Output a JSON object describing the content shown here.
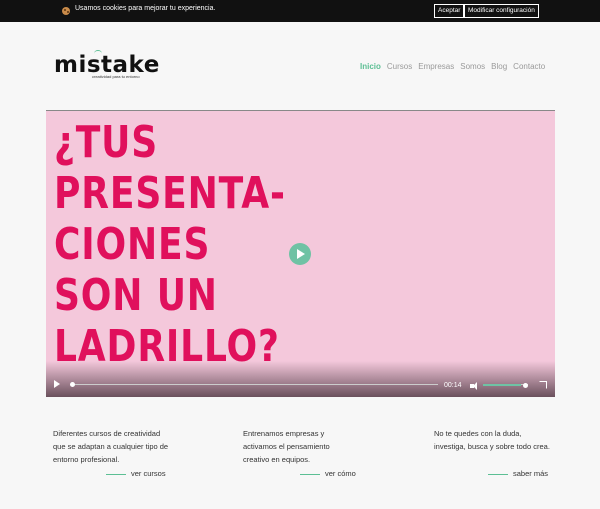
{
  "cookie": {
    "text": "Usamos cookies para mejorar tu experiencia.",
    "accept_label": "Aceptar",
    "settings_label": "Modificar configuración"
  },
  "logo": {
    "name": "mistake",
    "tagline": "creatividad para tu entorno"
  },
  "nav": {
    "items": [
      {
        "label": "Inicio",
        "active": true
      },
      {
        "label": "Cursos",
        "active": false
      },
      {
        "label": "Empresas",
        "active": false
      },
      {
        "label": "Somos",
        "active": false
      },
      {
        "label": "Blog",
        "active": false
      },
      {
        "label": "Contacto",
        "active": false
      }
    ]
  },
  "video": {
    "headline_lines": [
      "¿TUS",
      "PRESENTA-",
      "CIONES",
      "SON UN",
      "LADRILLO?"
    ],
    "time": "00:14",
    "progress": 0.0,
    "volume": 0.85
  },
  "features": [
    {
      "text": "Diferentes cursos de creatividad que se adaptan a cualquier tipo de entorno profesional.",
      "link": "ver cursos"
    },
    {
      "text": "Entrenamos empresas y activamos el pensamiento creativo en equipos.",
      "link": "ver cómo"
    },
    {
      "text": "No te quedes con la duda, investiga, busca y sobre todo crea.",
      "link": "saber más"
    }
  ],
  "colors": {
    "accent": "#5cbf94",
    "headline": "#e0105c",
    "video_bg": "#f4c8db",
    "cookie_bar": "#111111"
  }
}
